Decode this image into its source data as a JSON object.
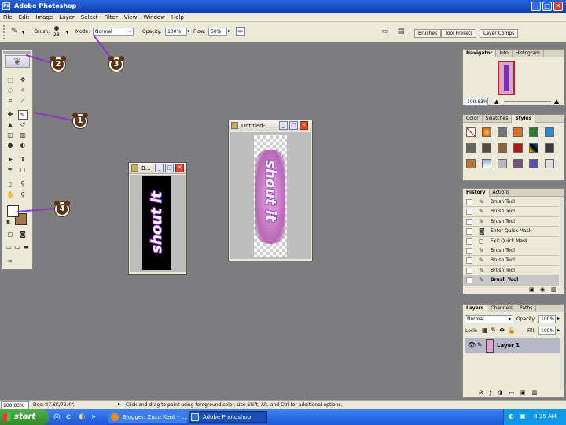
{
  "app": {
    "title": "Adobe Photoshop",
    "icon_text": "Ps"
  },
  "window_buttons": {
    "minimize": "_",
    "maximize": "□",
    "close": "✕"
  },
  "menu": [
    "File",
    "Edit",
    "Image",
    "Layer",
    "Select",
    "Filter",
    "View",
    "Window",
    "Help"
  ],
  "options_bar": {
    "brush_label": "Brush:",
    "brush_size": "28",
    "mode_label": "Mode:",
    "mode_value": "Normal",
    "opacity_label": "Opacity:",
    "opacity_value": "100%",
    "flow_label": "Flow:",
    "flow_value": "50%",
    "well_tabs": [
      "Brushes",
      "Tool Presets",
      "Layer Comps"
    ]
  },
  "annotations": [
    "1",
    "2",
    "3",
    "4"
  ],
  "doc_small": {
    "title": "B..."
  },
  "doc_large": {
    "title": "Untitled-..."
  },
  "artwork_text": "shout it",
  "navigator": {
    "tabs": [
      "Navigator",
      "Info",
      "Histogram"
    ],
    "zoom": "100.83%"
  },
  "styles_panel": {
    "tabs": [
      "Color",
      "Swatches",
      "Styles"
    ]
  },
  "history": {
    "tabs": [
      "History",
      "Actions"
    ],
    "items": [
      "Brush Tool",
      "Brush Tool",
      "Brush Tool",
      "Enter Quick Mask",
      "Exit Quick Mask",
      "Brush Tool",
      "Brush Tool",
      "Brush Tool",
      "Brush Tool"
    ],
    "selected_index": 8
  },
  "layers": {
    "tabs": [
      "Layers",
      "Channels",
      "Paths"
    ],
    "blend": "Normal",
    "opacity_label": "Opacity:",
    "opacity_value": "100%",
    "lock_label": "Lock:",
    "fill_label": "Fill:",
    "fill_value": "100%",
    "layer_name": "Layer 1"
  },
  "status": {
    "zoom": "100.83%",
    "doc": "Doc: 47.6K/72.4K",
    "hint": "Click and drag to paint using foreground color.  Use Shift, Alt, and Ctrl for additional options."
  },
  "taskbar": {
    "start": "start",
    "items": [
      "Blogger: Zuzu Kent - ...",
      "Adobe Photoshop"
    ],
    "clock": "8:35 AM"
  },
  "colors": {
    "accent": "#0a3fb8",
    "artwork_purple": "#8b2ad8",
    "foreground_swatch": "#ffffff",
    "background_swatch": "#a07a4a"
  },
  "icons": [
    "feather-icon",
    "brush-icon",
    "marquee-icon",
    "move-icon",
    "lasso-icon",
    "wand-icon",
    "crop-icon",
    "slice-icon",
    "heal-icon",
    "pencil-icon",
    "stamp-icon",
    "eraser-icon",
    "gradient-icon",
    "dodge-icon",
    "path-select-icon",
    "type-icon",
    "pen-icon",
    "shape-icon",
    "notes-icon",
    "eyedropper-icon",
    "hand-icon",
    "zoom-icon",
    "eye-icon",
    "trash-icon"
  ]
}
